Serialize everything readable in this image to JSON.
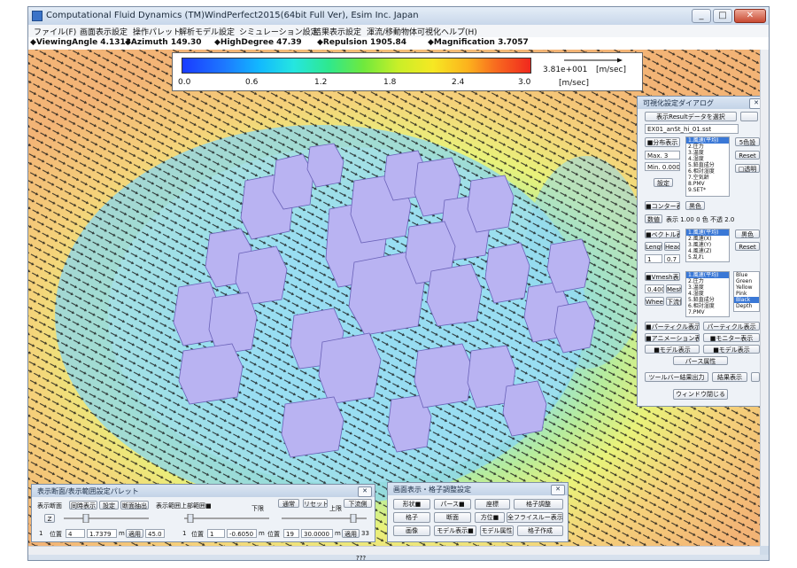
{
  "window": {
    "title": "Computational Fluid Dynamics (TM)WindPerfect2015(64bit Full Ver), Esim Inc. Japan",
    "buttons": [
      "_",
      "□",
      "✕"
    ]
  },
  "menu": [
    "ファイル(F)",
    "画面表示設定",
    "操作パレット",
    "解析モデル設定",
    "シミュレーション設定",
    "結果表示設定",
    "渾流/移動物体可視化",
    "ヘルプ(H)"
  ],
  "info": {
    "viewing_angle": "◆ViewingAngle 4.1313",
    "azimuth": "◆Azimuth 149.30",
    "high_degree": "◆HighDegree 47.39",
    "repulsion": "◆Repulsion 1905.84",
    "magnification": "◆Magnification 3.7057"
  },
  "legend": {
    "ticks": [
      "0.0",
      "0.6",
      "1.2",
      "1.8",
      "2.4",
      "3.0"
    ],
    "vector_ref": "3.81e+001",
    "vector_unit": "[m/sec]",
    "unit": "[m/sec]",
    "colors": [
      "#1a3bff",
      "#12b8ff",
      "#2ee88e",
      "#c9ef28",
      "#fcb21d",
      "#f0281e"
    ]
  },
  "dialog_right": {
    "title": "可視化設定ダイアログ",
    "select_result_btn": "表示Resultデータを選択",
    "result_file": "EX01_anSt_hi_01.sst",
    "dist_btn": "■分布表示",
    "max_field": "Max. 3",
    "min_field": "Min. 0.00000",
    "set_btn": "設定",
    "s_btn": "5色設",
    "reset_btn": "Reset",
    "trans_btn": "□透明",
    "list_a": [
      "1.風速(平均)",
      "2.圧力",
      "3.温度",
      "4.湿度",
      "5.鉛直成分",
      "6.相対湿度",
      "7.空気齢",
      "8.PMV",
      "9.SET*"
    ],
    "contour_btn": "■コンター表示",
    "color_btn": "黒色",
    "default_btn": "数値",
    "default_vals": [
      "表示",
      "1.00",
      "0",
      "色",
      "不透",
      "2.0"
    ],
    "vec_btn": "■ベクトル表示",
    "length_btn": "Length",
    "head_btn": "Head",
    "len_val": "1",
    "head_val": "0.7",
    "list_b": [
      "1.風速(平均)",
      "2.風速(X)",
      "3.風速(Y)",
      "4.風速(Z)",
      "5.乱れ"
    ],
    "vec_color_btn": "黒色",
    "reset2_btn": "Reset",
    "vmesh_btn": "■Vmesh表示",
    "mesh_val": "0.4000",
    "mesh_btn": "Mesh",
    "wheel_btn": "Wheel",
    "step_btn": "下流側",
    "list_c": [
      "1.風速(平均)",
      "2.圧力",
      "3.温度",
      "4.湿度",
      "5.鉛直成分",
      "6.相対湿度",
      "7.PMV"
    ],
    "list_d": [
      "Blue",
      "Green",
      "Yellow",
      "Pink",
      "Black",
      "Depth"
    ],
    "r1_left": "■パーティクル表示",
    "r1_right": "パーティクル表示",
    "r2_left": "■アニメーション表示",
    "r2_right": "■モニター表示",
    "r3_left": "■モデル表示",
    "r3_right": "■モデル表示",
    "r4": "パース属性",
    "r5_left": "ツールバー結果出力",
    "r5_right": "結果表示",
    "close_btn": "ウィンドウ閉じる"
  },
  "dialog_bottom_left": {
    "title": "表示断面/表示範囲設定パレット",
    "row1": [
      "表示断面",
      "同時表示",
      "設定",
      "断面抽出",
      "表示範囲上部範囲■",
      "下限",
      "通常",
      "リセット",
      "上限",
      "下流側"
    ],
    "z_btn": "Z",
    "row3": [
      "1",
      "位置",
      "4",
      "1.7379",
      "m",
      "適用",
      "45.0",
      "1",
      "位置",
      "1",
      "-0.6050",
      "m",
      "位置",
      "19",
      "30.0000",
      "m",
      "適用",
      "33"
    ]
  },
  "dialog_bottom_mid": {
    "title": "画面表示・格子調整設定",
    "buttons": [
      "形状■",
      "パース■",
      "座標",
      "格子調整",
      "格子",
      "断面",
      "方位■",
      "全フライスルー表示■",
      "画像",
      "モデル表示■",
      "モデル属性",
      "格子作成"
    ]
  },
  "status": {
    "center": "???"
  }
}
